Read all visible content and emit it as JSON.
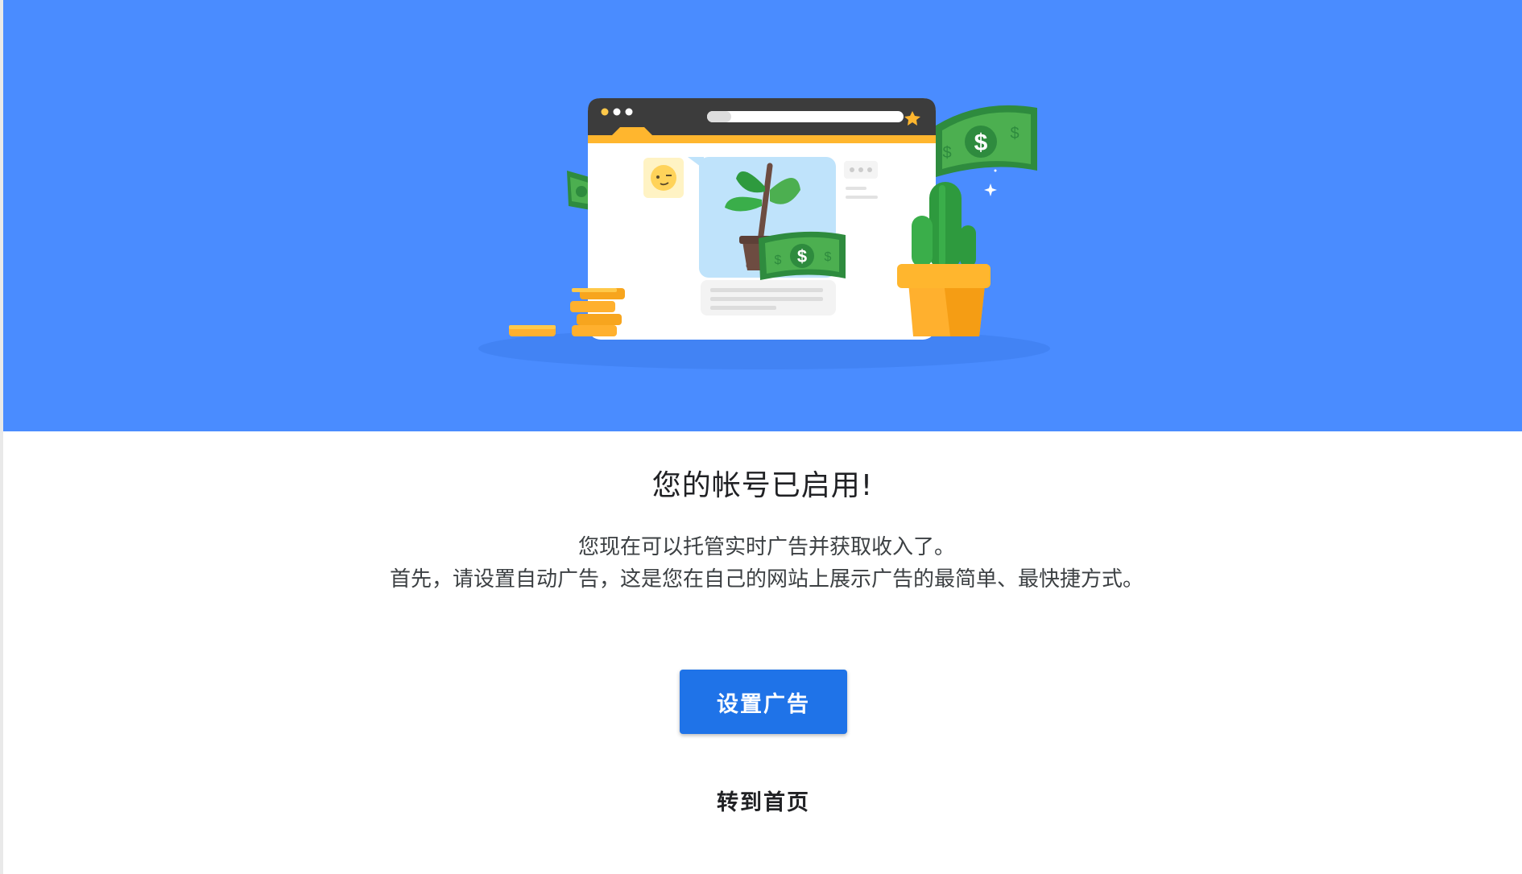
{
  "hero": {
    "background_color": "#4a8cff",
    "illustration": {
      "icons": [
        "browser-window-icon",
        "plant-icon",
        "cash-bill-icon",
        "coin-stack-icon",
        "cactus-pot-icon",
        "emoji-face-icon",
        "star-icon",
        "sparkle-icon"
      ]
    }
  },
  "main": {
    "title": "您的帐号已启用!",
    "description_lines": [
      "您现在可以托管实时广告并获取收入了。",
      "首先，请设置自动广告，这是您在自己的网站上展示广告的最简单、最快捷方式。"
    ],
    "primary_button_label": "设置广告",
    "secondary_link_label": "转到首页"
  },
  "colors": {
    "accent": "#1f73e8",
    "hero_blue": "#4a8cff",
    "money_green": "#3a9a4a",
    "coin_yellow": "#ffb02e"
  }
}
